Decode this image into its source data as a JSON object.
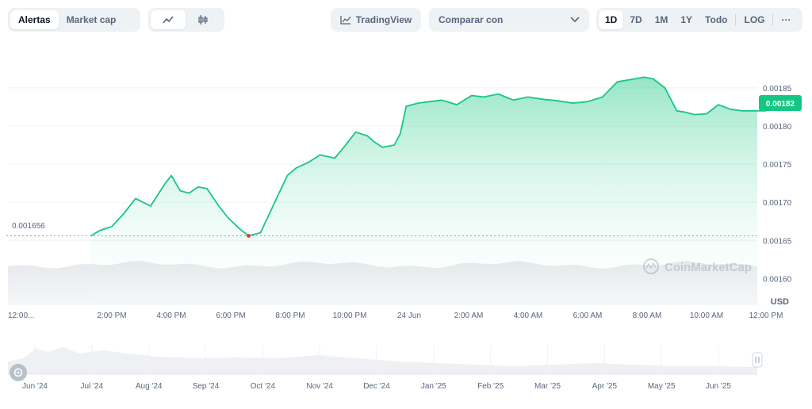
{
  "toolbar": {
    "tabs": [
      {
        "label": "Alertas",
        "active": true
      },
      {
        "label": "Market cap",
        "active": false
      }
    ],
    "chart_types": [
      "line",
      "candles"
    ],
    "tradingview_label": "TradingView",
    "compare_label": "Comparar con",
    "ranges": [
      "1D",
      "7D",
      "1M",
      "1Y",
      "Todo"
    ],
    "active_range": "1D",
    "log_label": "LOG",
    "more_label": "···"
  },
  "colors": {
    "line": "#16c784",
    "fill_top": "#16c784",
    "price_tag": "#16c784",
    "axis_text": "#58667e",
    "grid": "#eff2f5",
    "low_dot": "#ea3943"
  },
  "watermark": "CoinMarketCap",
  "start_price_label": "0.001656",
  "current_price_label": "0.00182",
  "currency": "USD",
  "chart_data": {
    "type": "area",
    "y_ticks": [
      "0.00185",
      "0.00180",
      "0.00175",
      "0.00170",
      "0.00165",
      "0.00160"
    ],
    "ylim": [
      0.001565,
      0.001905
    ],
    "x_ticks": [
      "12:00...",
      "2:00 PM",
      "4:00 PM",
      "6:00 PM",
      "8:00 PM",
      "10:00 PM",
      "24 Jun",
      "2:00 AM",
      "4:00 AM",
      "6:00 AM",
      "8:00 AM",
      "10:00 AM",
      "12:00 PM"
    ],
    "x_hours": [
      0,
      2,
      4,
      6,
      8,
      10,
      12,
      14,
      16,
      18,
      20,
      22,
      24
    ],
    "series": [
      {
        "x": [
          1.3,
          1.6,
          2.0,
          2.4,
          2.8,
          3.3,
          3.8,
          4.0,
          4.3,
          4.6,
          4.9,
          5.2,
          5.6,
          5.9,
          6.3,
          6.6,
          7.0,
          7.3,
          7.6,
          7.9,
          8.2,
          8.6,
          9.0,
          9.5,
          9.8,
          10.2,
          10.6,
          10.8,
          11.1,
          11.5,
          11.7,
          11.9,
          12.3,
          12.7,
          13.1,
          13.6,
          14.1,
          14.5,
          15.0,
          15.5,
          16.0,
          16.5,
          17.0,
          17.5,
          18.0,
          18.5,
          19.0,
          19.3,
          19.6,
          19.9,
          20.2,
          20.6,
          21.0,
          21.3,
          21.6,
          22.0,
          22.4,
          22.8,
          23.2,
          23.6,
          24.0
        ],
        "y": [
          0.001656,
          0.001663,
          0.001668,
          0.001685,
          0.001705,
          0.001695,
          0.001725,
          0.001735,
          0.001715,
          0.001712,
          0.00172,
          0.001718,
          0.001695,
          0.00168,
          0.001665,
          0.001656,
          0.00166,
          0.001685,
          0.00171,
          0.001735,
          0.001745,
          0.001752,
          0.001762,
          0.001758,
          0.001772,
          0.001792,
          0.001787,
          0.00178,
          0.001772,
          0.001775,
          0.00179,
          0.001826,
          0.00183,
          0.001832,
          0.001834,
          0.001828,
          0.00184,
          0.001838,
          0.001842,
          0.001834,
          0.001838,
          0.001835,
          0.001833,
          0.00183,
          0.001832,
          0.001838,
          0.001858,
          0.00186,
          0.001862,
          0.001864,
          0.001862,
          0.00185,
          0.00182,
          0.001818,
          0.001815,
          0.001816,
          0.001828,
          0.001822,
          0.00182,
          0.00182,
          0.00182
        ]
      }
    ],
    "overview_ticks": [
      "Jun '24",
      "Jul '24",
      "Aug '24",
      "Sep '24",
      "Oct '24",
      "Nov '24",
      "Dec '24",
      "Jan '25",
      "Feb '25",
      "Mar '25",
      "Apr '25",
      "May '25",
      "Jun '25"
    ]
  }
}
